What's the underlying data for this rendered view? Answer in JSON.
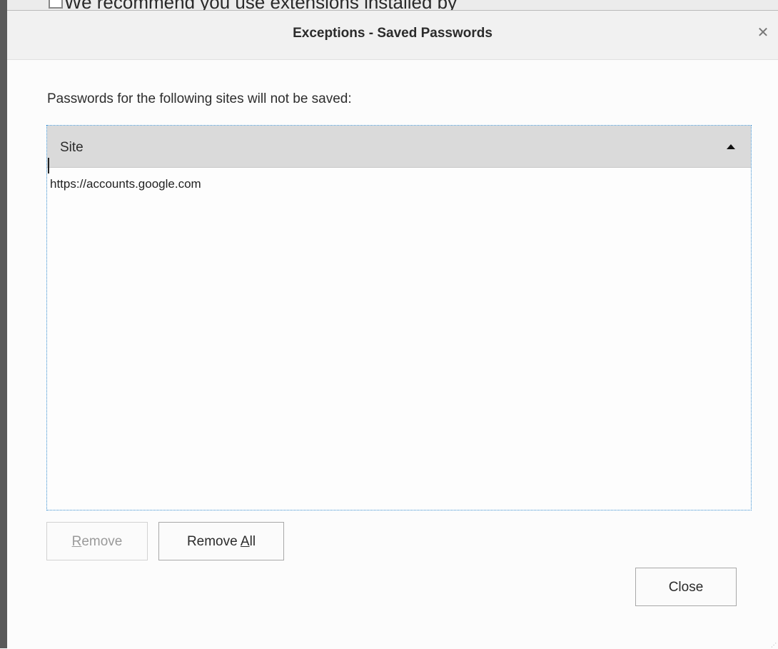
{
  "background_window": {
    "partial_text": "We recommend you use extensions installed by"
  },
  "dialog": {
    "title": "Exceptions - Saved Passwords",
    "close_icon": "close-icon",
    "description": "Passwords for the following sites will not be saved:",
    "table": {
      "columns": [
        {
          "label": "Site",
          "sort": "ascending"
        }
      ],
      "rows": [
        {
          "site": "https://accounts.google.com"
        }
      ]
    },
    "buttons": {
      "remove": {
        "prefix": "",
        "accel": "R",
        "suffix": "emove",
        "enabled": false
      },
      "remove_all": {
        "prefix": "Remove ",
        "accel": "A",
        "suffix": "ll",
        "enabled": true
      },
      "close": {
        "label": "Close",
        "enabled": true
      }
    }
  },
  "colors": {
    "focus_border": "#3a8fd1",
    "header_bg": "#dadada",
    "titlebar_bg": "#f1f1f1"
  }
}
